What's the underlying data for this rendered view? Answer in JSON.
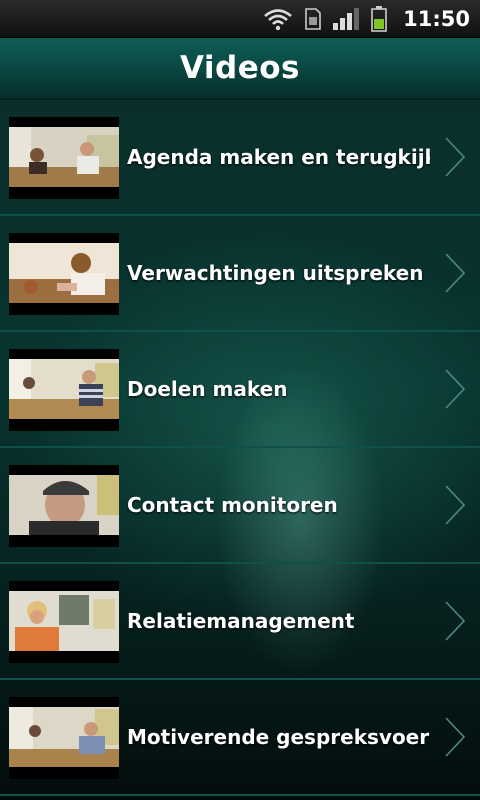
{
  "status_bar": {
    "time": "11:50",
    "icons": [
      "wifi-icon",
      "sim-card-icon",
      "signal-icon",
      "battery-icon"
    ]
  },
  "header": {
    "title": "Videos"
  },
  "videos": [
    {
      "title": "Agenda maken en terugkijken"
    },
    {
      "title": "Verwachtingen uitspreken"
    },
    {
      "title": "Doelen maken"
    },
    {
      "title": "Contact monitoren"
    },
    {
      "title": "Relatiemanagement"
    },
    {
      "title": "Motiverende gespreksvoering"
    }
  ],
  "colors": {
    "header_top": "#0f5e57",
    "background": "#083430",
    "divider": "#0f5048",
    "battery": "#7fc61e"
  }
}
